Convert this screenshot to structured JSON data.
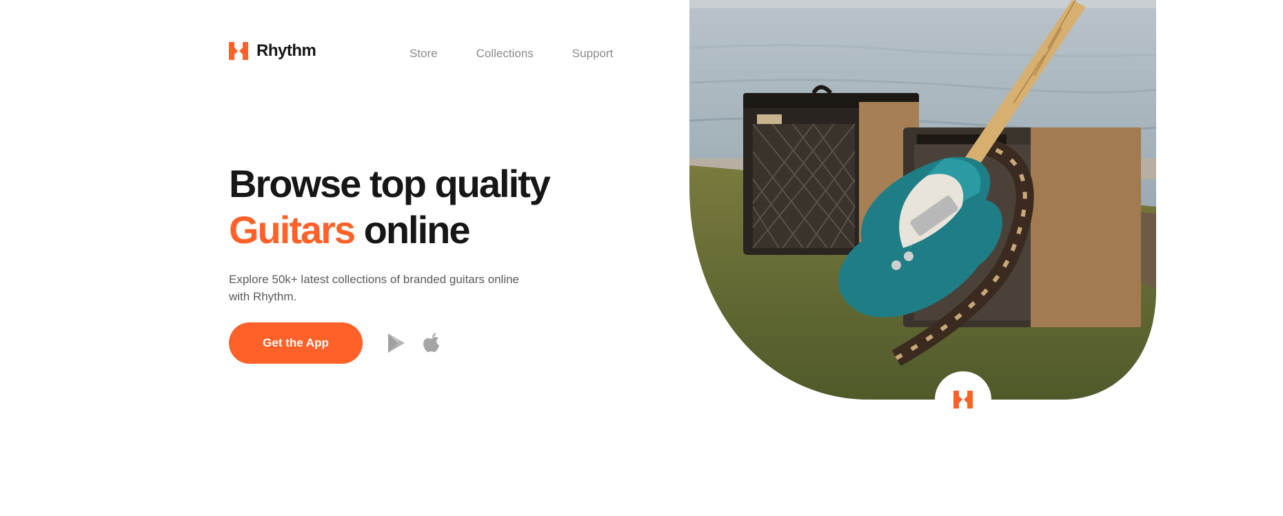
{
  "brand": {
    "name": "Rhythm",
    "logo_icon": "rhythm-bowtie-logo",
    "accent_color": "#ff6128"
  },
  "nav": [
    {
      "label": "Store"
    },
    {
      "label": "Collections"
    },
    {
      "label": "Support"
    }
  ],
  "hero": {
    "headline_line1": "Browse top quality",
    "headline_accent": "Guitars",
    "headline_rest": "online",
    "description": "Explore 50k+ latest collections of branded guitars online with Rhythm.",
    "cta_label": "Get the App",
    "store_icons": [
      "google-play-icon",
      "apple-icon"
    ]
  },
  "image": {
    "subject": "teal electric guitar leaning on two amplifiers on grass by the sea"
  }
}
